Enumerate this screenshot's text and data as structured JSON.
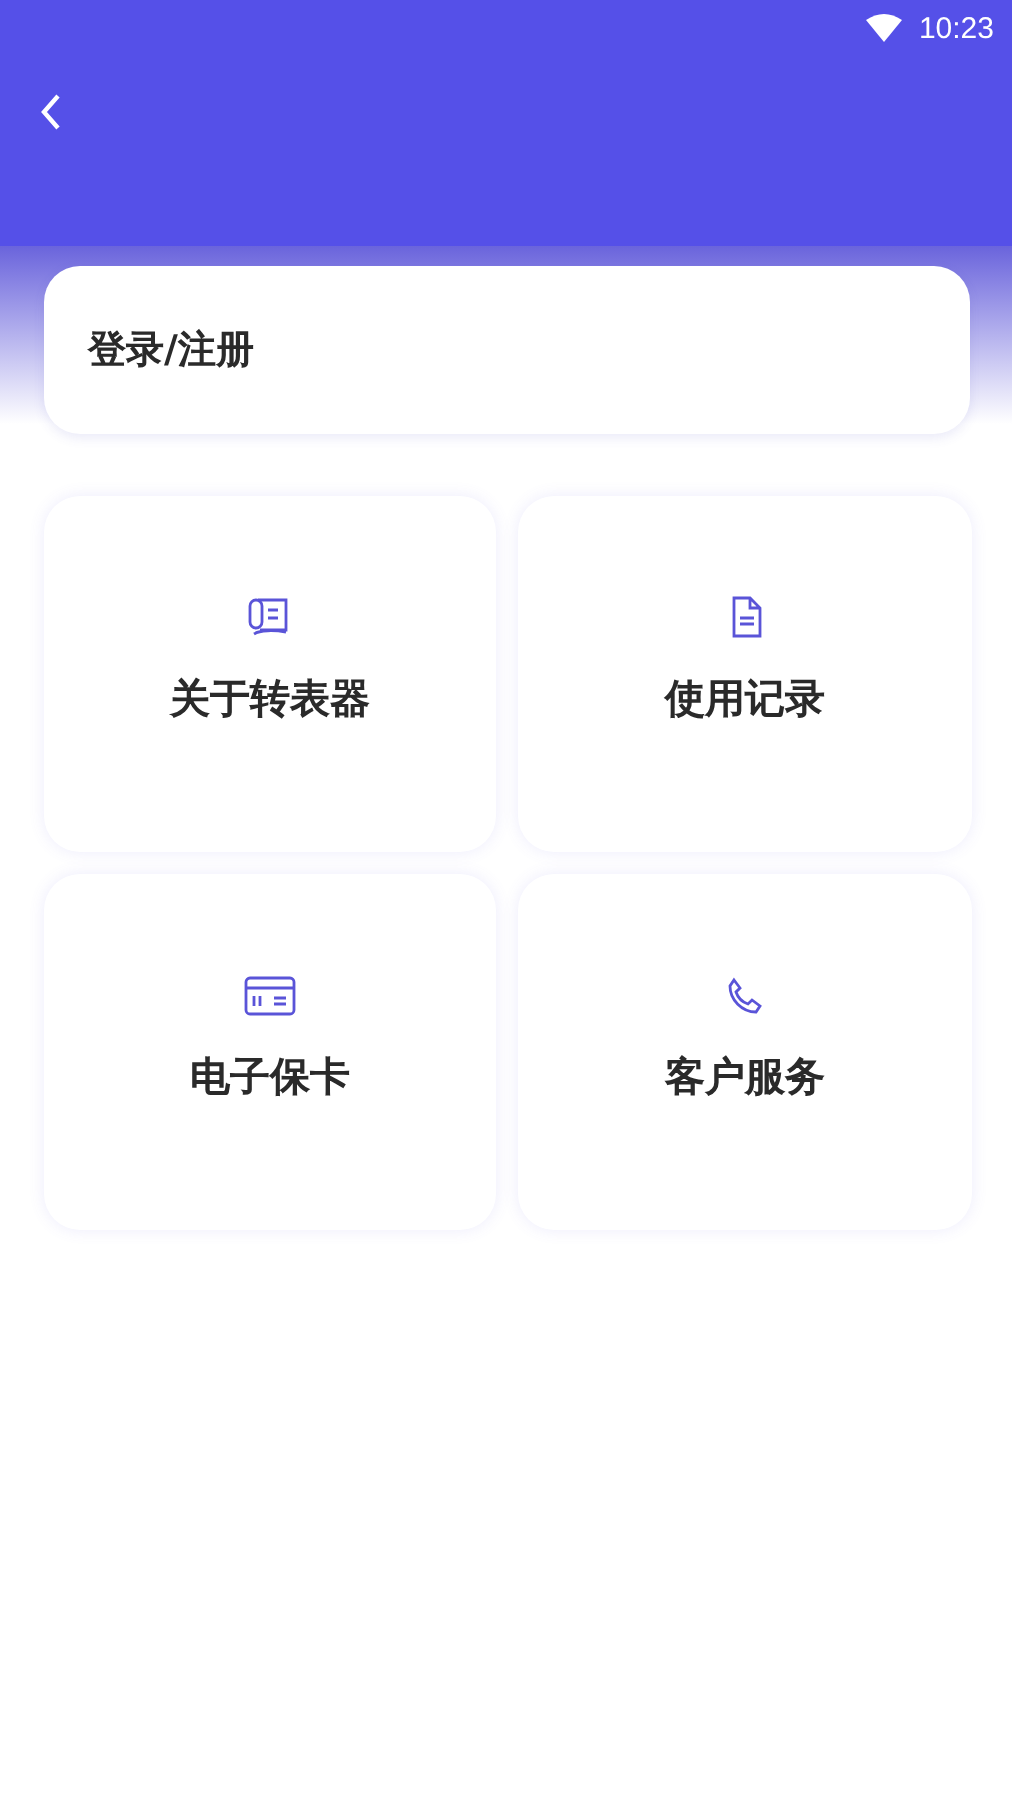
{
  "status_bar": {
    "time": "10:23"
  },
  "login": {
    "label": "登录/注册"
  },
  "menu": [
    {
      "kind": "device",
      "label": "关于转表器"
    },
    {
      "kind": "document",
      "label": "使用记录"
    },
    {
      "kind": "card",
      "label": "电子保卡"
    },
    {
      "kind": "phone",
      "label": "客户服务"
    }
  ]
}
